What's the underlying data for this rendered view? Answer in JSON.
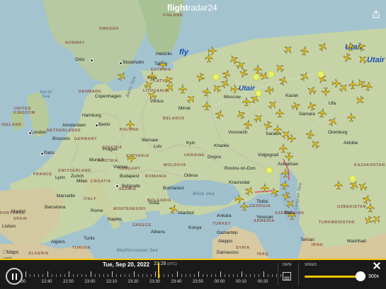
{
  "app": {
    "logo_prefix": "flight",
    "logo_suffix": "radar24"
  },
  "countries": [
    "SWEDEN",
    "NORWAY",
    "FINLAND",
    "ESTONIA",
    "LATVIA",
    "LITHUANIA",
    "UNITED KINGDOM",
    "IRELAND",
    "DENMARK",
    "NETHERLANDS",
    "GERMANY",
    "POLAND",
    "BELARUS",
    "FRANCE",
    "SWITZERLAND",
    "AUSTRIA",
    "CZECHIA",
    "SLOVAKIA",
    "HUNGARY",
    "ROMANIA",
    "MOLDOVA",
    "UKRAINE",
    "SERBIA",
    "BULGARIA",
    "ITALY",
    "CROATIA",
    "SPAIN",
    "PORTUGAL",
    "GREECE",
    "TURKEY",
    "ALGERIA",
    "TUNISIA",
    "GEORGIA",
    "AZERBAIJAN",
    "ARMENIA",
    "SYRIA",
    "IRAQ",
    "IRAN",
    "KAZAKHSTAN",
    "UZBEKISTAN",
    "TURKMENISTAN",
    "MONTENEGRO"
  ],
  "cities": [
    "Oslo",
    "Stockholm",
    "Helsinki",
    "Tallinn",
    "Riga",
    "Copenhagen",
    "Minsk",
    "Vilnius",
    "Hamburg",
    "Berlin",
    "London",
    "Amsterdam",
    "Brussels",
    "Paris",
    "Warsaw",
    "Prague",
    "Vienna",
    "Munich",
    "Zurich",
    "Milan",
    "Lyon",
    "Marseille",
    "Barcelona",
    "Madrid",
    "Lisbon",
    "Rome",
    "Naples",
    "Budapest",
    "Bucharest",
    "Belgrade",
    "Sofia",
    "Istanbul",
    "Ankara",
    "Athens",
    "Tunis",
    "Algiers",
    "Kyiv",
    "Kharkiv",
    "Dnipro",
    "Odesa",
    "Lviv",
    "Moscow",
    "Voronezh",
    "Volgograd",
    "Saratov",
    "Samara",
    "Kazan",
    "Rostov-on-Don",
    "Krasnodar",
    "Tbilisi",
    "Yerevan",
    "Baku",
    "Aleppo",
    "Damascus",
    "Tehran",
    "Mashhad",
    "Astrakhan",
    "Orenburg",
    "Ufa",
    "Aktobe",
    "Gaziantep",
    "Konya"
  ],
  "seas": [
    "North Sea",
    "Baltic Sea",
    "Black Sea",
    "Mediterranean Sea",
    "Caspian Sea"
  ],
  "airlines": {
    "utair_1": "Utair",
    "utair_2": "Utair",
    "utair_3": "Utair",
    "fly": "fly"
  },
  "attribution": {
    "maps": "Maps",
    "legal": "Legal"
  },
  "playback": {
    "date": "Tue, Sep 20, 2022",
    "time": "23:28",
    "tz": "(UTC)",
    "ticks": [
      ":30",
      "22:40",
      "22:50",
      "23:00",
      "23:10",
      "23:20",
      "23:30",
      "23:40",
      "23:50",
      "00:00",
      "00:10",
      "00:20"
    ],
    "date_label": "DATE",
    "speed_label": "SPEED",
    "speed_value": "300x",
    "speed_level": 0.9
  }
}
